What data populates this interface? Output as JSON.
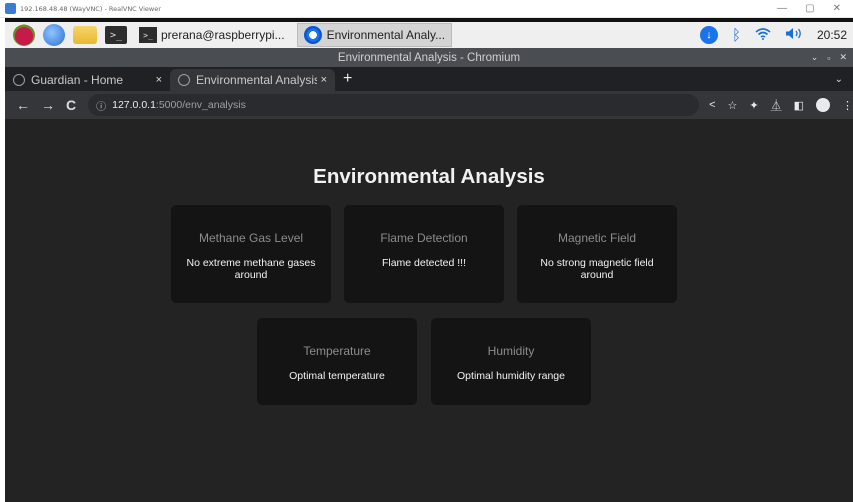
{
  "vnc": {
    "title": "192.168.48.48 (WayVNC) - RealVNC Viewer",
    "minimize": "—",
    "restore": "▢",
    "close": "✕"
  },
  "taskbar": {
    "terminal_glyph": ">_",
    "tasks": [
      {
        "label": "prerana@raspberrypi..."
      },
      {
        "label": "Environmental Analy..."
      }
    ],
    "clock": "20:52"
  },
  "window": {
    "title": "Environmental Analysis - Chromium",
    "ctrl_min": "⌄",
    "ctrl_max": "▫",
    "ctrl_close": "✕"
  },
  "tabs": [
    {
      "label": "Guardian - Home",
      "close": "×"
    },
    {
      "label": "Environmental Analysis",
      "close": "×"
    }
  ],
  "new_tab": "+",
  "tab_menu": "⌄",
  "toolbar": {
    "back": "←",
    "forward": "→",
    "reload": "C",
    "info": "ⓘ",
    "url_host": "127.0.0.1",
    "url_rest": ":5000/env_analysis",
    "share": "<",
    "star": "☆",
    "menu": "⋮"
  },
  "page": {
    "title": "Environmental Analysis",
    "cards": [
      {
        "heading": "Methane Gas Level",
        "status": "No extreme methane gases around"
      },
      {
        "heading": "Flame Detection",
        "status": "Flame detected !!!"
      },
      {
        "heading": "Magnetic Field",
        "status": "No strong magnetic field around"
      },
      {
        "heading": "Temperature",
        "status": "Optimal temperature"
      },
      {
        "heading": "Humidity",
        "status": "Optimal humidity range"
      }
    ]
  },
  "colors": {
    "page_bg": "#232323",
    "card_bg": "#141414",
    "heading_text": "#8c8c8c",
    "status_text": "#f2f2f2"
  }
}
